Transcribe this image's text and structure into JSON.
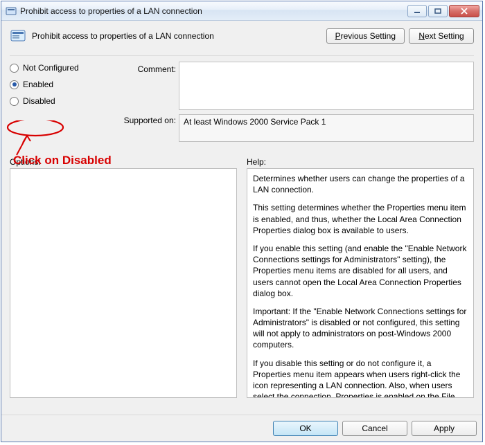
{
  "window": {
    "title": "Prohibit access to properties of a LAN connection"
  },
  "header": {
    "title": "Prohibit access to properties of a LAN connection",
    "prev_label": "Previous Setting",
    "next_label": "Next Setting",
    "prev_hotkey": "P",
    "next_hotkey": "N"
  },
  "radios": {
    "not_configured": "Not Configured",
    "enabled": "Enabled",
    "disabled": "Disabled",
    "selected": "enabled"
  },
  "labels": {
    "comment": "Comment:",
    "supported": "Supported on:",
    "options": "Options:",
    "help": "Help:"
  },
  "comment_value": "",
  "supported_value": "At least Windows 2000 Service Pack 1",
  "help_paragraphs": [
    "Determines whether users can change the properties of a LAN connection.",
    "This setting determines whether the Properties menu item is enabled, and thus, whether the Local Area Connection Properties dialog box is available to users.",
    "If you enable this setting (and enable the \"Enable Network Connections settings for Administrators\" setting), the Properties menu items are disabled for all users, and users cannot open the Local Area Connection Properties dialog box.",
    "Important: If the \"Enable Network Connections settings for Administrators\" is disabled or not configured, this setting will not apply to administrators on post-Windows 2000 computers.",
    "If you disable this setting or do not configure it, a Properties menu item appears when users right-click the icon representing a LAN connection. Also, when users select the connection, Properties is enabled on the File menu."
  ],
  "footer": {
    "ok": "OK",
    "cancel": "Cancel",
    "apply": "Apply"
  },
  "annotation": {
    "text": "Click on Disabled"
  }
}
